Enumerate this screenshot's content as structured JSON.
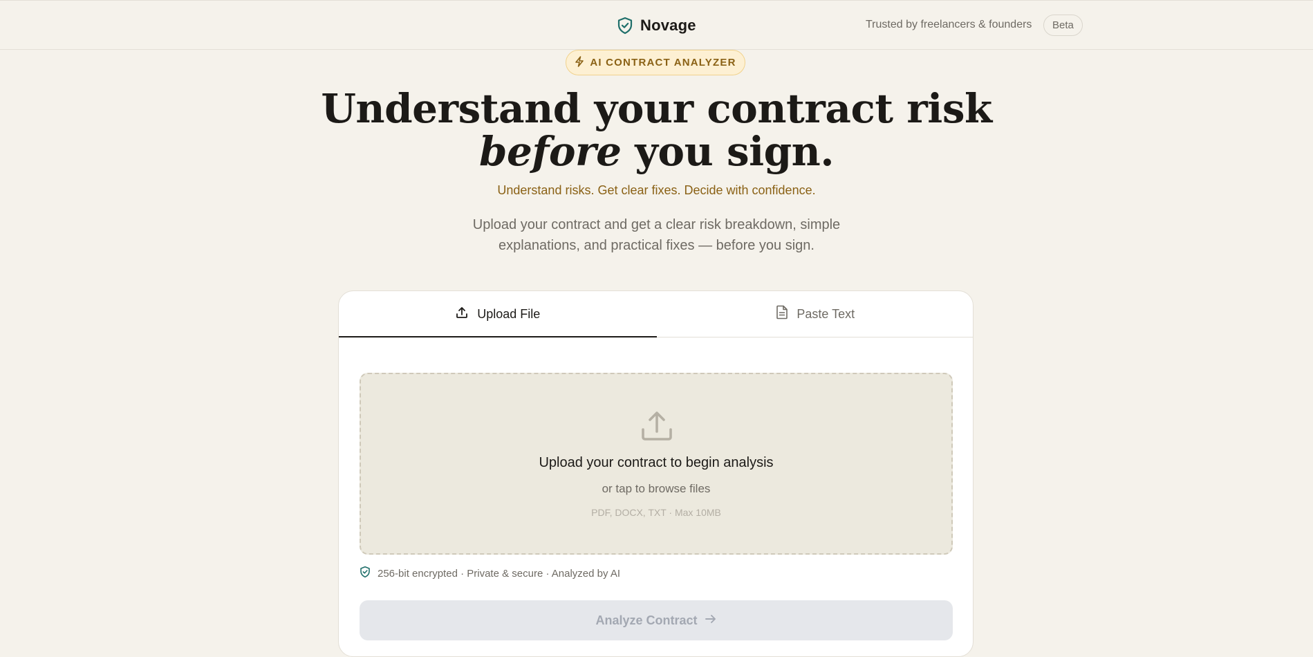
{
  "header": {
    "brand_name": "Novage",
    "brand_icon": "shield-check-icon",
    "trust_text": "Trusted by freelancers & founders",
    "badge": "Beta"
  },
  "hero": {
    "pill_label": "AI CONTRACT ANALYZER",
    "pill_icon": "lightning-icon",
    "headline_line1": "Understand your contract risk",
    "headline_em": "before",
    "headline_rest": " you sign.",
    "tagline": "Understand risks. Get clear fixes. Decide with confidence.",
    "lede_line1": "Upload your contract and get a clear risk breakdown, simple",
    "lede_line2": "explanations, and practical fixes — before you sign."
  },
  "card": {
    "tabs": [
      {
        "label": "Upload File",
        "icon": "upload-icon",
        "active": true
      },
      {
        "label": "Paste Text",
        "icon": "document-icon",
        "active": false
      }
    ],
    "dropzone": {
      "icon": "upload-tray-icon",
      "title": "Upload your contract to begin analysis",
      "subtitle": "or tap to browse files",
      "hint": "PDF, DOCX, TXT · Max 10MB"
    },
    "security_note": "256-bit encrypted · Private & secure · Analyzed by AI",
    "security_icon": "shield-check-icon",
    "analyze_label": "Analyze Contract",
    "analyze_icon": "arrow-right-icon",
    "analyze_disabled": true
  },
  "colors": {
    "background": "#f5f2eb",
    "accent_gold": "#8a6115",
    "shield_teal": "#1f6f6a",
    "text_primary": "#1c1a17",
    "text_muted": "#6e6a63"
  }
}
